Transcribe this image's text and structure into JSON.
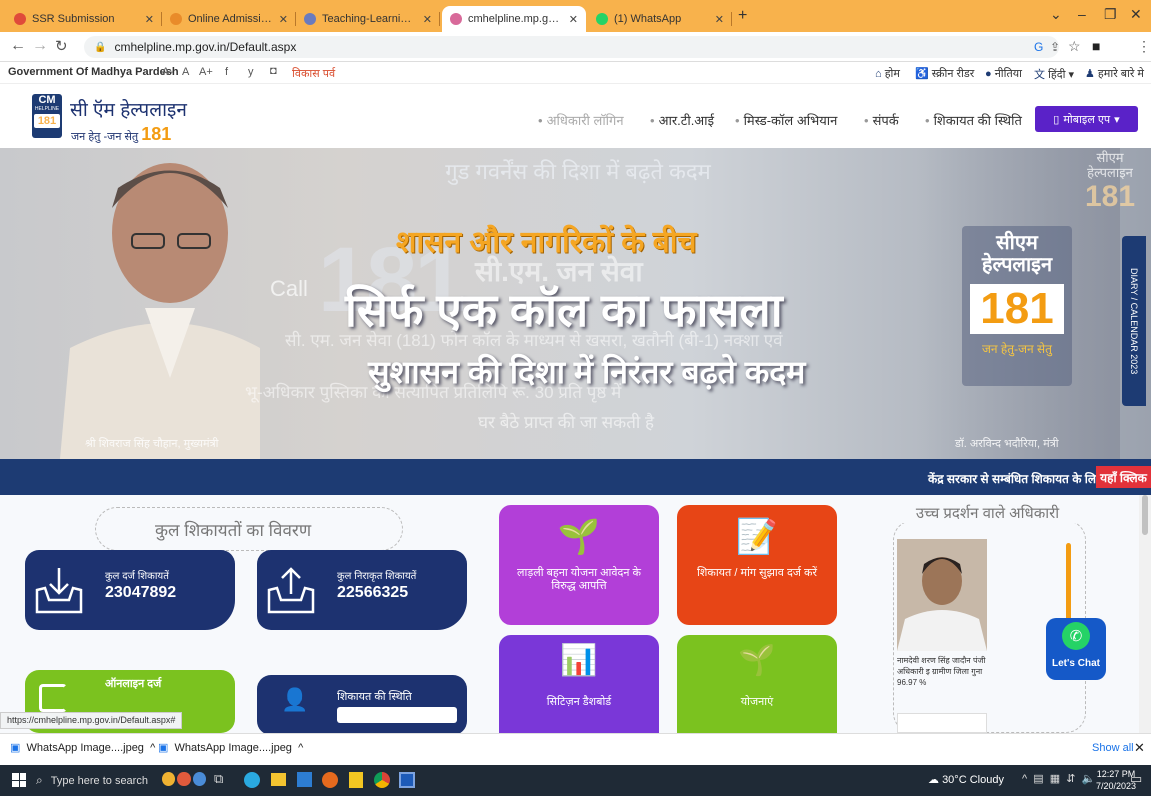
{
  "browser": {
    "tabs": [
      {
        "label": "SSR Submission",
        "fav_color": "#e04a3a"
      },
      {
        "label": "Online Admission, Madhya Prade",
        "fav_color": "#e98b2a"
      },
      {
        "label": "Teaching-Learning and Evaluatio",
        "fav_color": "#6a7bbd"
      },
      {
        "label": "cmhelpline.mp.gov.in/Default.as",
        "fav_color": "#d86a9a"
      },
      {
        "label": "(1) WhatsApp",
        "fav_color": "#25d366"
      }
    ],
    "url": "cmhelpline.mp.gov.in/Default.aspx"
  },
  "govbar": {
    "org": "Government Of Madhya Pardesh",
    "font_sizes": [
      "A-",
      "A",
      "A+"
    ],
    "social": [
      "f",
      "y",
      "◘"
    ],
    "vikas": "विकास पर्व",
    "links": [
      "होम",
      "स्क्रीन रीडर",
      "नीतिया",
      "हिंदी",
      "हमारे बारे मे"
    ]
  },
  "header": {
    "logo_cm": "CM",
    "logo_helpline": "HELPLINE",
    "logo_num": "181",
    "title": "सी ऍम हेल्पलाइन",
    "tagline": "जन हेतु -जन सेतु",
    "tagline_num": "181",
    "nav": [
      "अधिकारी लॉगिन",
      "आर.टी.आई",
      "मिस्ड-कॉल अभियान",
      "संपर्क",
      "शिकायत की स्थिति"
    ],
    "mobile_app": "मोबाइल एप"
  },
  "banner": {
    "top_caption": "गुड गवर्नेंस की दिशा में बढ़ते कदम",
    "line1": "शासन और नागरिकों के बीच",
    "line2": "सिर्फ एक कॉल का फासला",
    "line3": "सुशासन की दिशा में निरंतर बढ़ते कदम",
    "bg_num": "181",
    "call": "Call",
    "bg_sub": "सी.एम. जन सेवा",
    "bg_text1": "सी. एम. जन सेवा (181) फोन कॉल के माध्यम से खसरा, खतौनी (बी-1) नक्शा एवं",
    "bg_text2": "भू-अधिकार पुस्तिका की सत्यापित प्रतिलिपि रू. 30 प्रति पृष्ठ में",
    "bg_text3": "घर बैठे प्राप्त की जा सकती है",
    "right_title": "सीएम हेल्पलाइन",
    "right_num": "181",
    "right_tag": "जन हेतु-जन सेतु",
    "corner_title": "सीएम हेल्पलाइन",
    "corner_num": "181",
    "caption_left": "श्री शिवराज सिंह चौहान, मुख्यमंत्री",
    "caption_right": "डॉ. अरविन्द भदौरिया, मंत्री",
    "diary": "DIARY / CALENDAR 2023"
  },
  "strip": {
    "text": "केंद्र सरकार से सम्बंधित शिकायत के लिए",
    "button": "यहाँ क्लिक"
  },
  "stats": {
    "heading": "कुल शिकायतों का विवरण",
    "received_label": "कुल दर्ज शिकायतें",
    "received_value": "23047892",
    "resolved_label": "कुल निराकृत शिकायतें",
    "resolved_value": "22566325",
    "online_label": "ऑनलाइन दर्ज",
    "status_label": "शिकायत की स्थिति"
  },
  "tiles": {
    "ladli": "लाड़ली बहना योजना आवेदन के विरुद्ध आपत्ति",
    "complaint": "शिकायत / मांग सुझाव दर्ज करें",
    "dashboard": "सिटिज़न डैशबोर्ड",
    "schemes": "योजनाएं"
  },
  "officers": {
    "heading": "उच्च प्रदर्शन वाले अधिकारी",
    "caption": "नामदेवी शरण सिंह जादौन पंजी अधिकारी इ ग्रामीण जिला गुना 96.97 %"
  },
  "chat": {
    "label": "Let's Chat"
  },
  "status_url": "https://cmhelpline.mp.gov.in/Default.aspx#",
  "downloads": {
    "items": [
      "WhatsApp Image....jpeg",
      "WhatsApp Image....jpeg"
    ],
    "show_all": "Show all"
  },
  "taskbar": {
    "search": "Type here to search",
    "weather": "30°C  Cloudy",
    "time": "12:27 PM",
    "date": "7/20/2023"
  }
}
